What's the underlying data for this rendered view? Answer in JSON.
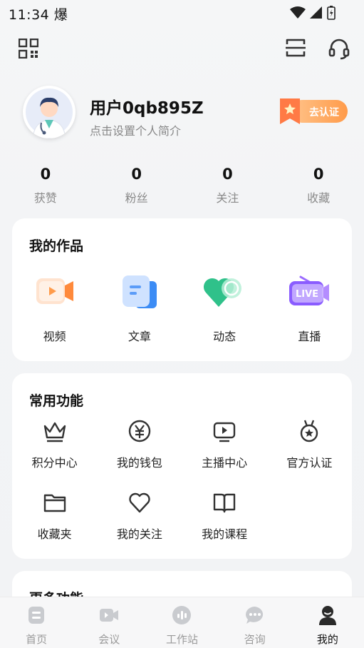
{
  "status_bar": {
    "time": "11:34",
    "extra": "爆"
  },
  "profile": {
    "username": "用户0qb895Z",
    "bio": "点击设置个人简介",
    "verify_label": "去认证"
  },
  "stats": [
    {
      "value": "0",
      "label": "获赞"
    },
    {
      "value": "0",
      "label": "粉丝"
    },
    {
      "value": "0",
      "label": "关注"
    },
    {
      "value": "0",
      "label": "收藏"
    }
  ],
  "works": {
    "title": "我的作品",
    "items": [
      {
        "label": "视频",
        "icon": "video-icon"
      },
      {
        "label": "文章",
        "icon": "article-icon"
      },
      {
        "label": "动态",
        "icon": "moments-heart-icon"
      },
      {
        "label": "直播",
        "icon": "live-icon",
        "badge": "LIVE"
      }
    ]
  },
  "functions": {
    "title": "常用功能",
    "items": [
      {
        "label": "积分中心",
        "icon": "crown-icon"
      },
      {
        "label": "我的钱包",
        "icon": "yen-coin-icon"
      },
      {
        "label": "主播中心",
        "icon": "play-screen-icon"
      },
      {
        "label": "官方认证",
        "icon": "medal-icon"
      },
      {
        "label": "收藏夹",
        "icon": "folder-icon"
      },
      {
        "label": "我的关注",
        "icon": "heart-icon"
      },
      {
        "label": "我的课程",
        "icon": "book-icon"
      }
    ]
  },
  "more": {
    "title": "更多功能"
  },
  "nav": [
    {
      "label": "首页",
      "icon": "home-icon",
      "active": false
    },
    {
      "label": "会议",
      "icon": "meeting-camera-icon",
      "active": false
    },
    {
      "label": "工作站",
      "icon": "workstation-icon",
      "active": false
    },
    {
      "label": "咨询",
      "icon": "chat-icon",
      "active": false
    },
    {
      "label": "我的",
      "icon": "profile-icon",
      "active": true
    }
  ],
  "colors": {
    "accent_orange": "#ff9b4a",
    "nav_inactive": "#c9cbcf",
    "text_primary": "#111111"
  }
}
